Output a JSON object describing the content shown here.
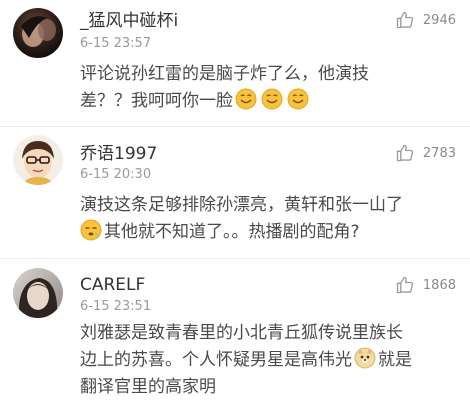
{
  "comments": [
    {
      "username": "_猛风中碰杯i",
      "time": "6-15 23:57",
      "likes": "2946",
      "lines": [
        {
          "parts": [
            {
              "text": "评论说孙红雷的是脑子炸了么，他演技"
            }
          ]
        },
        {
          "parts": [
            {
              "text": "差？？我呵呵你一脸"
            }
          ],
          "emojis_after": [
            "smiley-emoji",
            "smiley-emoji",
            "smiley-emoji"
          ]
        }
      ]
    },
    {
      "username": "乔语1997",
      "time": "6-15 20:30",
      "likes": "2783",
      "lines": [
        {
          "parts": [
            {
              "text": "演技这条足够排除孙漂亮，黄轩和张一山了"
            }
          ]
        },
        {
          "emoji_before": "sleepy-emoji",
          "parts": [
            {
              "text": "其他就不知道了。。热播剧的配角?"
            }
          ]
        }
      ]
    },
    {
      "username": "CARELF",
      "time": "6-15 23:51",
      "likes": "1868",
      "lines": [
        {
          "parts": [
            {
              "text": "刘雅瑟是致青春里的小北青丘狐传说里族长"
            }
          ]
        },
        {
          "parts": [
            {
              "text": "边上的苏喜。个人怀疑男星是高伟光"
            }
          ],
          "emoji_mid": "doge-emoji",
          "parts_after": [
            {
              "text": "就是"
            }
          ]
        },
        {
          "parts": [
            {
              "text": "翻译官里的高家明"
            }
          ]
        }
      ]
    }
  ]
}
